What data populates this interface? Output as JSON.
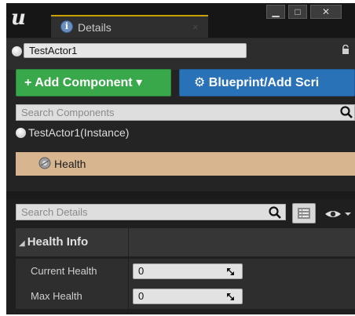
{
  "window": {
    "logo_glyph": "u",
    "tab_label": "Details",
    "tab_close_glyph": "×",
    "minimize_glyph": "▁",
    "maximize_glyph": "□",
    "close_glyph": "✕"
  },
  "actor": {
    "name": "TestActor1"
  },
  "toolbar": {
    "add_component_label": "+ Add Component ▾",
    "blueprint_label": "⚙ Blueprint/Add Scri"
  },
  "components": {
    "search_placeholder": "Search Components",
    "instance_label": "TestActor1(Instance)",
    "selected_label": "Health"
  },
  "details": {
    "search_placeholder": "Search Details",
    "category_arrow": "◢",
    "category_label": "Health Info",
    "properties": [
      {
        "label": "Current Health",
        "value": "0"
      },
      {
        "label": "Max Health",
        "value": "0"
      }
    ]
  },
  "colors": {
    "add_button": "#38a84a",
    "blueprint_button": "#2a72b8",
    "selected_row": "#d6b58f",
    "tab_accent": "#c7a200"
  }
}
